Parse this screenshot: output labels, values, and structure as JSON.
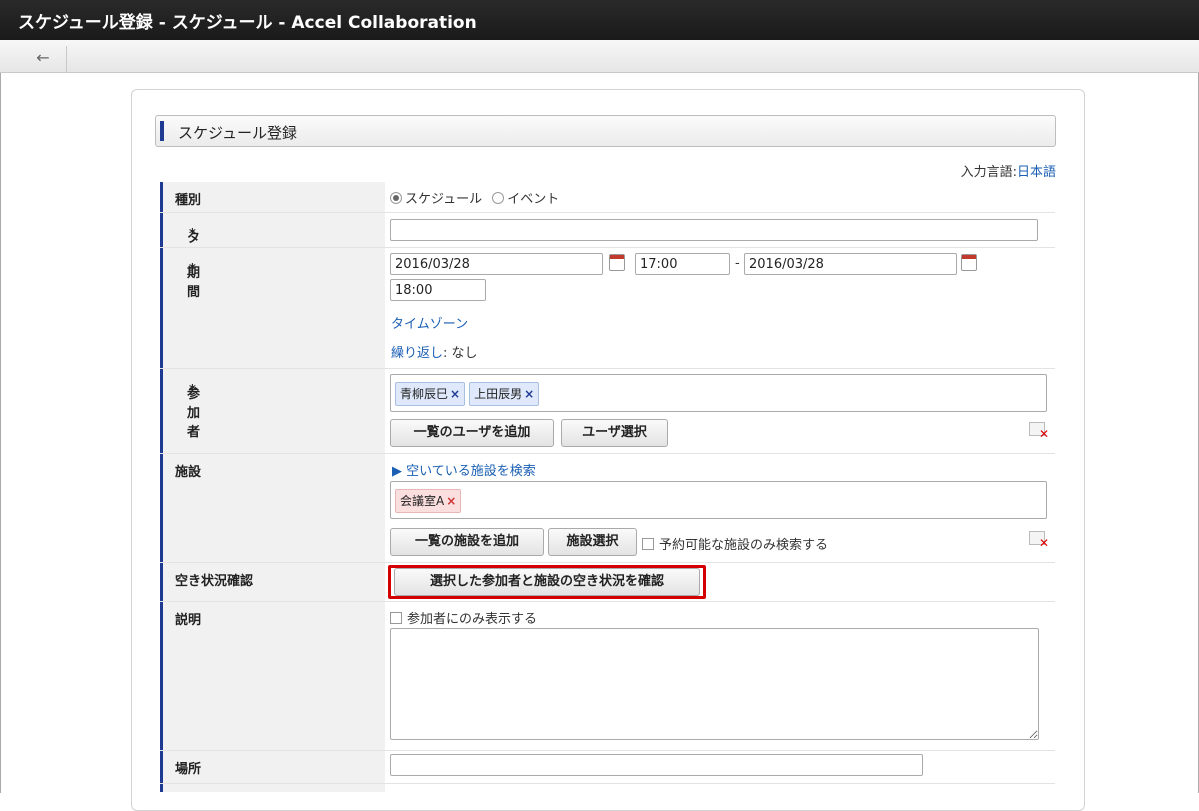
{
  "window": {
    "title": "スケジュール登録 - スケジュール - Accel Collaboration"
  },
  "toolbar": {
    "back_icon": "←"
  },
  "section": {
    "title": "スケジュール登録"
  },
  "lang": {
    "label": "入力言語:",
    "value": "日本語"
  },
  "fields": {
    "type": {
      "label": "種別",
      "opt1": "スケジュール",
      "opt2": "イベント",
      "selected": "スケジュール"
    },
    "title": {
      "label": "タイトル",
      "req": "*",
      "value": ""
    },
    "period": {
      "label": "期間",
      "req": "*",
      "start_date": "2016/03/28",
      "start_time": "17:00",
      "sep": "-",
      "end_date": "2016/03/28",
      "end_time": "18:00",
      "timezone_link": "タイムゾーン",
      "repeat_label": "繰り返し",
      "repeat_value": ": なし"
    },
    "participants": {
      "label": "参加者",
      "req": "*",
      "chips": [
        "青柳辰巳",
        "上田辰男"
      ],
      "add_button": "一覧のユーザを追加",
      "select_button": "ユーザ選択"
    },
    "facility": {
      "label": "施設",
      "search_link": "空いている施設を検索",
      "chips": [
        "会議室A"
      ],
      "add_button": "一覧の施設を追加",
      "select_button": "施設選択",
      "checkbox_label": "予約可能な施設のみ検索する"
    },
    "availability": {
      "label": "空き状況確認",
      "button": "選択した参加者と施設の空き状況を確認"
    },
    "description": {
      "label": "説明",
      "checkbox_label": "参加者にのみ表示する"
    },
    "location": {
      "label": "場所",
      "value": ""
    }
  },
  "colors": {
    "accent": "#1f3a93",
    "highlight": "#d40000",
    "link": "#1a5fb4"
  }
}
